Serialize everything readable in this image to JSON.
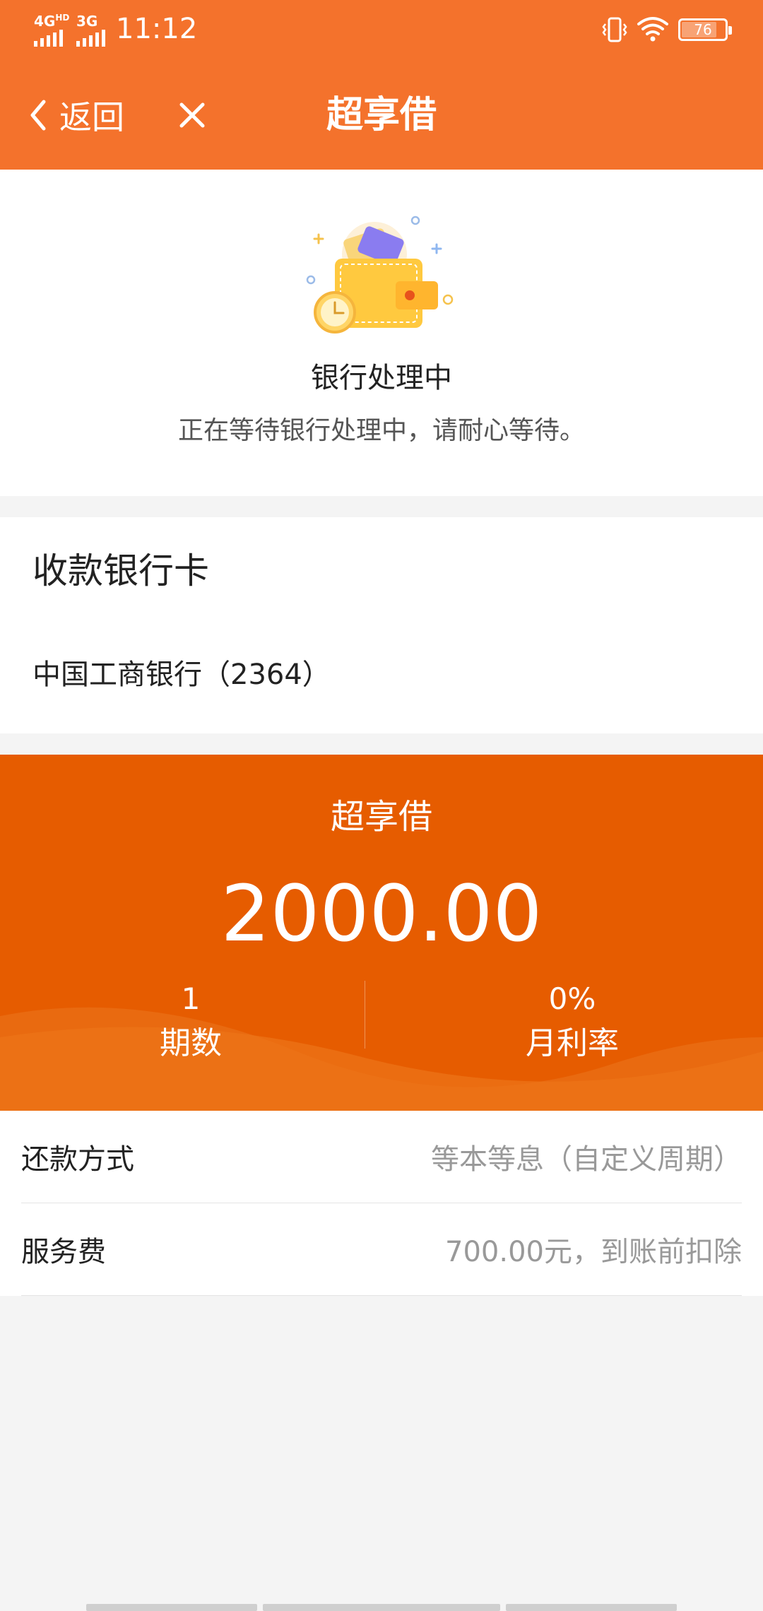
{
  "status_bar": {
    "network1": "4G",
    "network1_sup": "HD",
    "network2": "3G",
    "time": "11:12",
    "battery": "76"
  },
  "nav": {
    "back_label": "返回",
    "title": "超享借"
  },
  "status_card": {
    "title": "银行处理中",
    "description": "正在等待银行处理中，请耐心等待。"
  },
  "bank_card": {
    "title": "收款银行卡",
    "bank": "中国工商银行（2364）"
  },
  "loan": {
    "title": "超享借",
    "amount": "2000.00",
    "periods_value": "1",
    "periods_label": "期数",
    "rate_value": "0%",
    "rate_label": "月利率"
  },
  "info": {
    "repay_label": "还款方式",
    "repay_value": "等本等息（自定义周期）",
    "fee_label": "服务费",
    "fee_value": "700.00元，到账前扣除"
  },
  "colors": {
    "header": "#f4722c",
    "loan_bg": "#e65c00"
  }
}
